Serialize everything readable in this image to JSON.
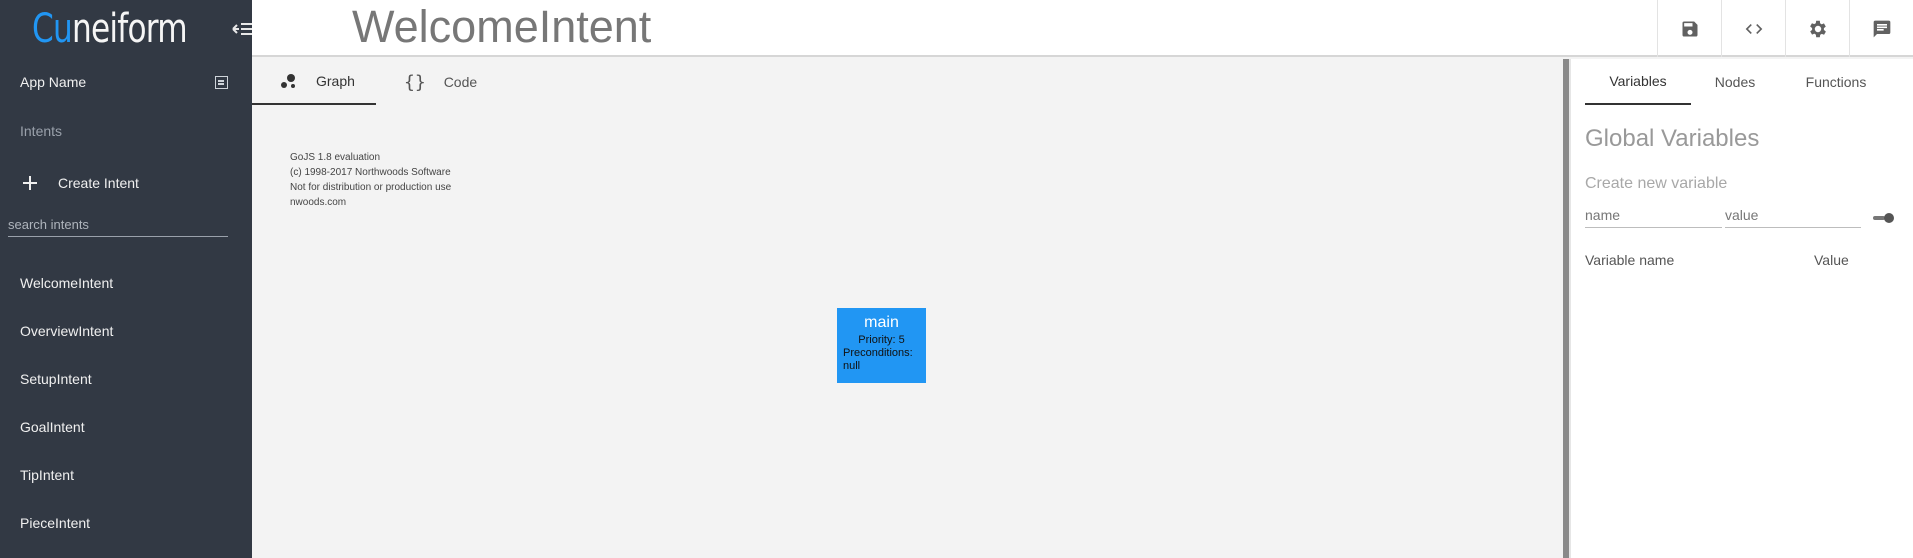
{
  "sidebar": {
    "logo": {
      "prefix": "Cu",
      "rest": "neiform"
    },
    "app_name": "App Name",
    "section_label": "Intents",
    "create_intent_label": "Create Intent",
    "search_placeholder": "search intents",
    "intents": [
      {
        "label": "WelcomeIntent"
      },
      {
        "label": "OverviewIntent"
      },
      {
        "label": "SetupIntent"
      },
      {
        "label": "GoalIntent"
      },
      {
        "label": "TipIntent"
      },
      {
        "label": "PieceIntent"
      }
    ]
  },
  "header": {
    "title": "WelcomeIntent",
    "actions": [
      "save-icon",
      "code-icon",
      "settings-icon",
      "chat-icon"
    ]
  },
  "center": {
    "tabs": [
      {
        "label": "Graph",
        "icon": "graph-icon",
        "active": true
      },
      {
        "label": "Code",
        "icon": "braces-icon",
        "active": false
      }
    ],
    "watermark": [
      "GoJS 1.8 evaluation",
      "(c) 1998-2017 Northwoods Software",
      "Not for distribution or production use",
      "nwoods.com"
    ],
    "node": {
      "title": "main",
      "priority": "Priority: 5",
      "preconditions_label": "Preconditions:",
      "preconditions_value": "null",
      "color": "#2196f3"
    }
  },
  "right_panel": {
    "tabs": [
      {
        "label": "Variables",
        "active": true
      },
      {
        "label": "Nodes",
        "active": false
      },
      {
        "label": "Functions",
        "active": false
      }
    ],
    "title": "Global Variables",
    "create_label": "Create new variable",
    "name_placeholder": "name",
    "value_placeholder": "value",
    "columns": [
      "Variable name",
      "Value"
    ]
  },
  "colors": {
    "sidebar_bg": "#323944",
    "accent": "#2196f3",
    "canvas_bg": "#f3f3f3"
  }
}
